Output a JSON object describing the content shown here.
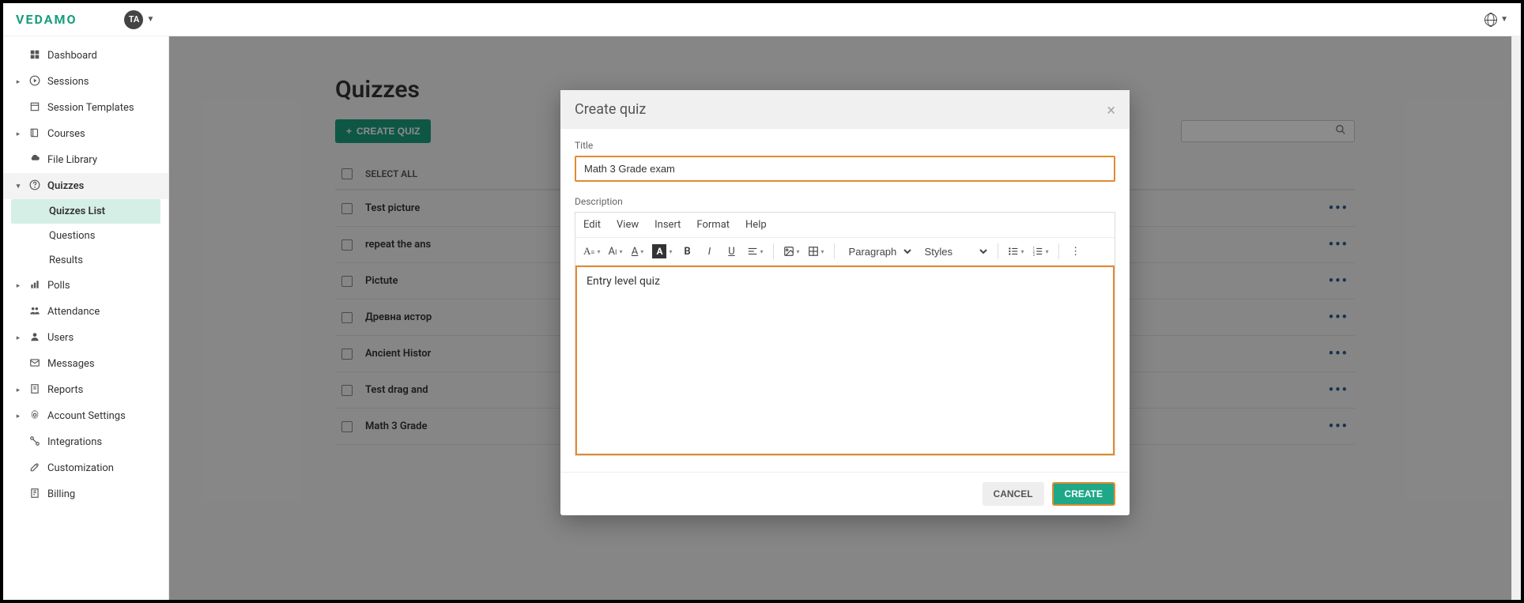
{
  "brand": "VEDAMO",
  "avatar_initials": "TA",
  "sidebar": {
    "items": [
      {
        "label": "Dashboard",
        "icon": "dashboard-icon",
        "caret": false
      },
      {
        "label": "Sessions",
        "icon": "play-icon",
        "caret": true
      },
      {
        "label": "Session Templates",
        "icon": "template-icon",
        "caret": false
      },
      {
        "label": "Courses",
        "icon": "book-icon",
        "caret": true
      },
      {
        "label": "File Library",
        "icon": "cloud-icon",
        "caret": false
      },
      {
        "label": "Quizzes",
        "icon": "help-icon",
        "caret": true,
        "expanded": true,
        "children": [
          {
            "label": "Quizzes List",
            "active": true
          },
          {
            "label": "Questions",
            "active": false
          },
          {
            "label": "Results",
            "active": false
          }
        ]
      },
      {
        "label": "Polls",
        "icon": "chart-icon",
        "caret": true
      },
      {
        "label": "Attendance",
        "icon": "people-icon",
        "caret": false
      },
      {
        "label": "Users",
        "icon": "users-icon",
        "caret": true
      },
      {
        "label": "Messages",
        "icon": "mail-icon",
        "caret": false
      },
      {
        "label": "Reports",
        "icon": "report-icon",
        "caret": true
      },
      {
        "label": "Account Settings",
        "icon": "gear-icon",
        "caret": true
      },
      {
        "label": "Integrations",
        "icon": "integrations-icon",
        "caret": false
      },
      {
        "label": "Customization",
        "icon": "tools-icon",
        "caret": false
      },
      {
        "label": "Billing",
        "icon": "billing-icon",
        "caret": false
      }
    ]
  },
  "page": {
    "title": "Quizzes",
    "create_quiz_btn": "CREATE QUIZ",
    "select_all": "SELECT ALL",
    "rows": [
      {
        "title": "Test picture"
      },
      {
        "title": "repeat the ans"
      },
      {
        "title": "Pictute"
      },
      {
        "title": "Древна истор"
      },
      {
        "title": "Ancient Histor"
      },
      {
        "title": "Test drag and"
      },
      {
        "title": "Math 3 Grade"
      }
    ]
  },
  "modal": {
    "title": "Create quiz",
    "title_label": "Title",
    "title_value": "Math 3 Grade exam",
    "description_label": "Description",
    "menu": {
      "edit": "Edit",
      "view": "View",
      "insert": "Insert",
      "format": "Format",
      "help": "Help"
    },
    "paragraph_select": "Paragraph",
    "styles_select": "Styles",
    "body_text": "Entry level quiz",
    "cancel": "CANCEL",
    "create": "CREATE"
  }
}
